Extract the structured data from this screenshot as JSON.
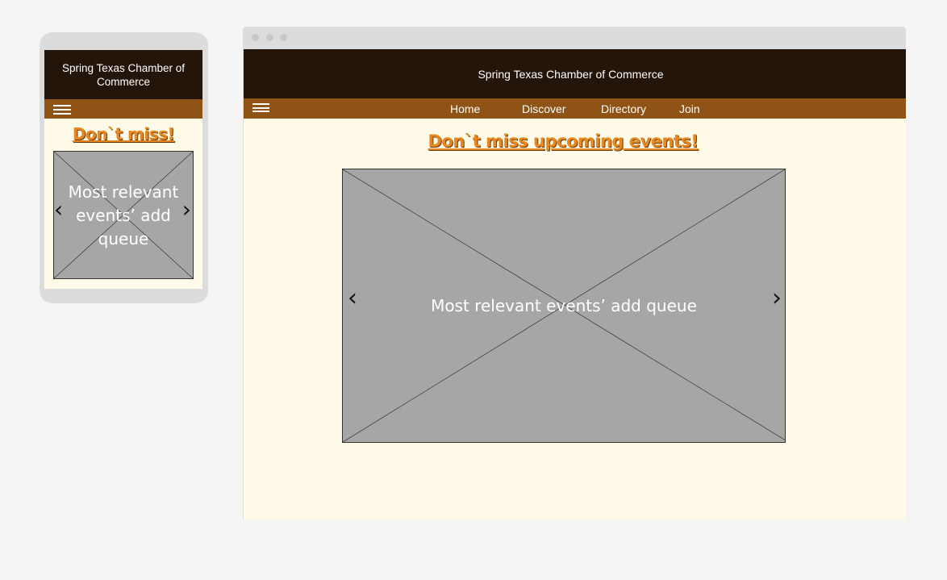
{
  "site_title": "Spring Texas Chamber of Commerce",
  "mobile": {
    "heading": "Don`t miss!",
    "carousel_text": "Most relevant events’ add queue"
  },
  "desktop": {
    "nav": [
      {
        "label": "Home"
      },
      {
        "label": "Discover"
      },
      {
        "label": "Directory"
      },
      {
        "label": "Join"
      }
    ],
    "heading": "Don`t miss upcoming events!",
    "carousel_text": "Most relevant events’ add queue"
  },
  "colors": {
    "header": "#23150a",
    "nav": "#8f5316",
    "background": "#fffbe8",
    "heading": "#e8871e",
    "placeholder": "#a6a6a6"
  },
  "icons": {
    "menu": "hamburger-icon",
    "prev": "chevron-left-icon",
    "next": "chevron-right-icon"
  }
}
